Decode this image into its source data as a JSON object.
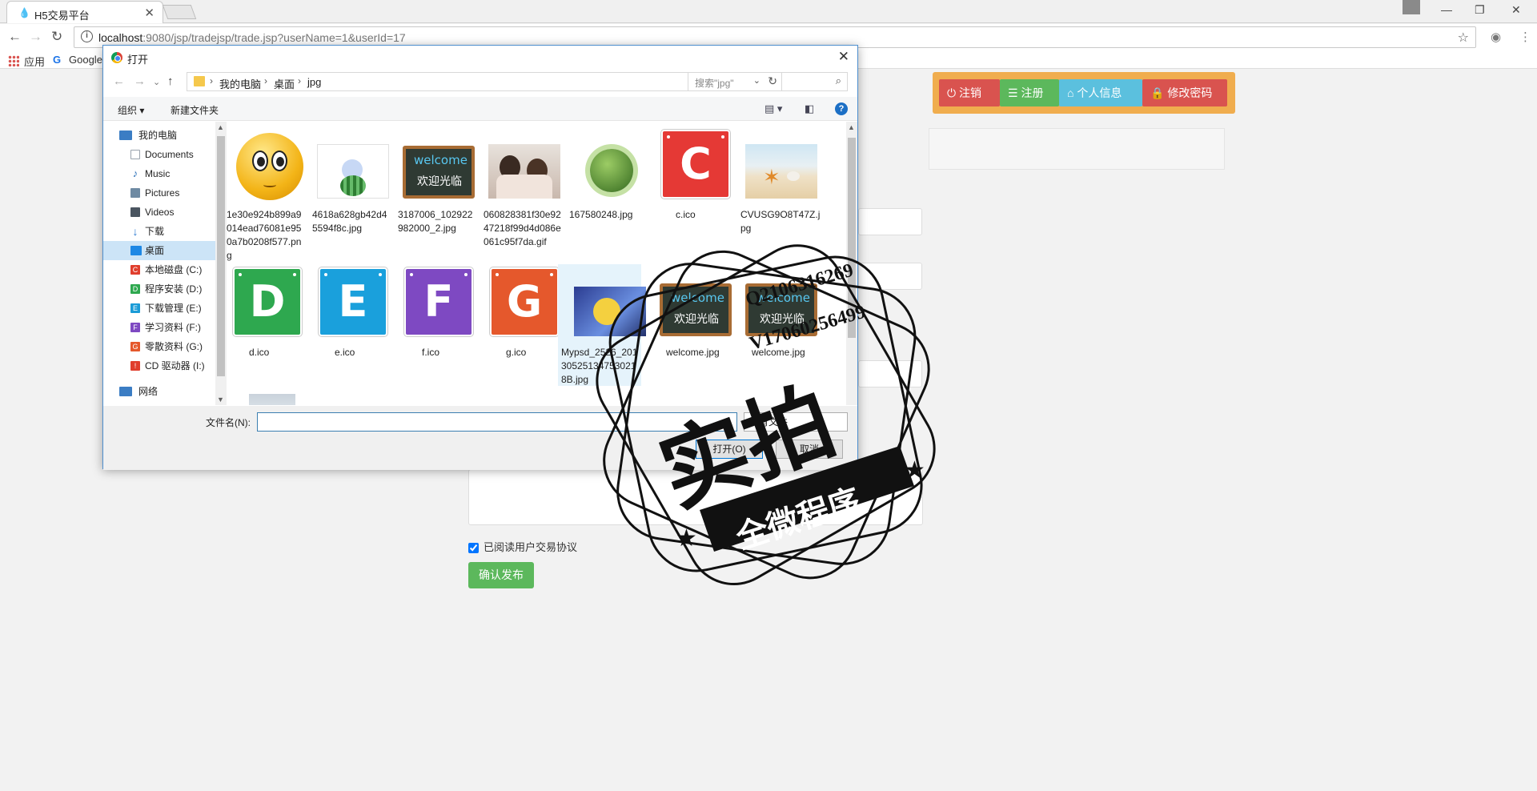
{
  "browser": {
    "tab_title": "H5交易平台",
    "url_host": "localhost",
    "url_rest": ":9080/jsp/tradejsp/trade.jsp?userName=1&userId=17",
    "bookmarks": [
      "应用",
      "Google"
    ]
  },
  "page": {
    "top_buttons": [
      {
        "label": "注销",
        "icon": "power-icon",
        "color": "#d9534f"
      },
      {
        "label": "注册",
        "icon": "list-icon",
        "color": "#5cb85c"
      },
      {
        "label": "个人信息",
        "icon": "home-icon",
        "color": "#5bc0de"
      },
      {
        "label": "修改密码",
        "icon": "lock-icon",
        "color": "#d9534f"
      }
    ],
    "agree_label": "已阅读用户交易协议",
    "agree_checked": true,
    "publish_label": "确认发布"
  },
  "dialog": {
    "title": "打开",
    "breadcrumbs": [
      "我的电脑",
      "桌面",
      "jpg"
    ],
    "search_placeholder": "搜索\"jpg\"",
    "organize_label": "组织 ▾",
    "new_folder_label": "新建文件夹",
    "nav": [
      {
        "label": "我的电脑",
        "icon": "computer-icon",
        "color": "#3b7dc4"
      },
      {
        "label": "Documents",
        "icon": "documents-icon",
        "color": "#9aa3ad"
      },
      {
        "label": "Music",
        "icon": "music-icon",
        "color": "#2a6fb8"
      },
      {
        "label": "Pictures",
        "icon": "pictures-icon",
        "color": "#6e8aa3"
      },
      {
        "label": "Videos",
        "icon": "videos-icon",
        "color": "#4a5560"
      },
      {
        "label": "下载",
        "icon": "download-icon",
        "color": "#2b7ad0"
      },
      {
        "label": "桌面",
        "icon": "desktop-icon",
        "color": "#1e88e5",
        "selected": true
      },
      {
        "label": "本地磁盘 (C:)",
        "icon": "drive-c-icon",
        "color": "#e03e2d"
      },
      {
        "label": "程序安装 (D:)",
        "icon": "drive-d-icon",
        "color": "#2ea84f"
      },
      {
        "label": "下载管理 (E:)",
        "icon": "drive-e-icon",
        "color": "#1a9bd7"
      },
      {
        "label": "学习资料 (F:)",
        "icon": "drive-f-icon",
        "color": "#7e49c2"
      },
      {
        "label": "零散资料 (G:)",
        "icon": "drive-g-icon",
        "color": "#e5582c"
      },
      {
        "label": "CD 驱动器 (I:)",
        "icon": "cd-drive-icon",
        "color": "#e03e2d"
      },
      {
        "label": "网络",
        "icon": "network-icon",
        "color": "#3b7dc4"
      }
    ],
    "files": [
      {
        "name": "1e30e924b899a9014ead76081e950a7b0208f577.png",
        "kind": "emoji"
      },
      {
        "name": "4618a628gb42d45594f8c.jpg",
        "kind": "watermelon"
      },
      {
        "name": "3187006_102922982000_2.jpg",
        "kind": "chalk"
      },
      {
        "name": "060828381f30e9247218f99d4d086e061c95f7da.gif",
        "kind": "kids"
      },
      {
        "name": "167580248.jpg",
        "kind": "globe"
      },
      {
        "name": "c.ico",
        "kind": "tile",
        "letter": "C",
        "color": "#e53935"
      },
      {
        "name": "CVUSG9O8T47Z.jpg",
        "kind": "beach"
      },
      {
        "name": "d.ico",
        "kind": "tile",
        "letter": "D",
        "color": "#2ea84f"
      },
      {
        "name": "e.ico",
        "kind": "tile",
        "letter": "E",
        "color": "#1aa0dc"
      },
      {
        "name": "f.ico",
        "kind": "tile",
        "letter": "F",
        "color": "#7e49c2"
      },
      {
        "name": "g.ico",
        "kind": "tile",
        "letter": "G",
        "color": "#e5582c"
      },
      {
        "name": "Mypsd_2526_201305251347530218B.jpg",
        "kind": "soccer",
        "selected": true
      },
      {
        "name": "welcome.jpg",
        "kind": "chalk"
      },
      {
        "name": "welcome.jpg",
        "kind": "chalk"
      }
    ],
    "chalk_word": "welcome",
    "chalk_cn": "欢迎光临",
    "filename_label": "文件名(N):",
    "filename_value": "",
    "filter_label": "所有文件",
    "open_label": "打开(O)",
    "cancel_label": "取消"
  },
  "watermark": {
    "main": "实拍",
    "banner": "全微程序",
    "contact_1": "Q2106316269",
    "contact_2": "V17060256499"
  }
}
